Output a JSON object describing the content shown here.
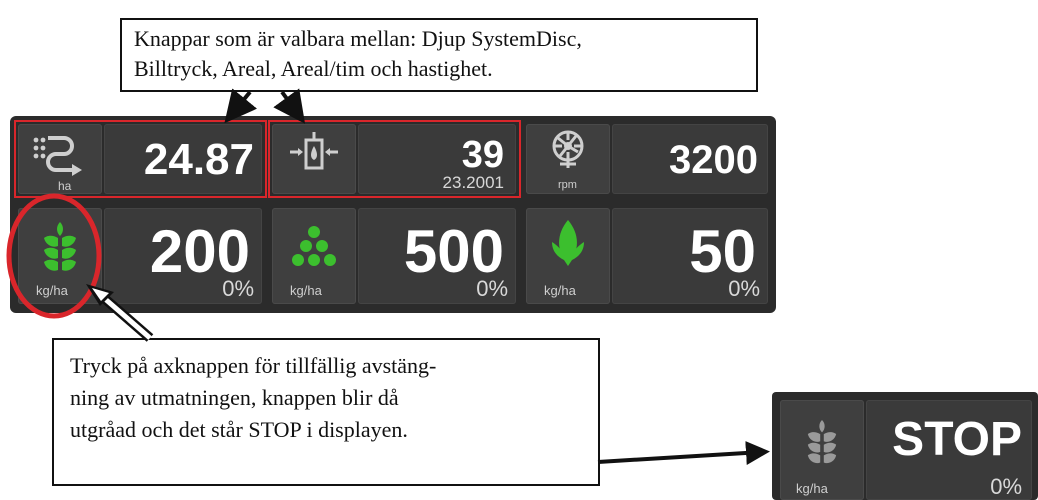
{
  "callouts": {
    "top": [
      "Knappar som är valbara mellan: Djup SystemDisc,",
      "Billtryck, Areal, Areal/tim och hastighet."
    ],
    "bottom": [
      "Tryck på  axknappen för tillfällig avstäng-",
      "ning av utmatningen, knappen blir då",
      "utgråad och det står STOP i displayen."
    ]
  },
  "display": {
    "row1": [
      {
        "icon": "area-route-icon",
        "unit": "ha",
        "value": "24.87",
        "sub": ""
      },
      {
        "icon": "pressure-depth-icon",
        "unit": "",
        "value": "39",
        "sub": "23.2001"
      },
      {
        "icon": "fan-icon",
        "unit": "rpm",
        "value": "3200",
        "sub": ""
      }
    ],
    "row2": [
      {
        "icon": "wheat-icon",
        "unit": "kg/ha",
        "value": "200",
        "sub": "0%"
      },
      {
        "icon": "seed-dots-icon",
        "unit": "kg/ha",
        "value": "500",
        "sub": "0%"
      },
      {
        "icon": "leaf-icon",
        "unit": "kg/ha",
        "value": "50",
        "sub": "0%"
      }
    ]
  },
  "stop_display": {
    "icon": "wheat-grey-icon",
    "unit": "kg/ha",
    "value": "STOP",
    "sub": "0%"
  },
  "colors": {
    "panel": "#2b2b2b",
    "cell": "#3a3a3a",
    "green": "#3cbf2e",
    "highlight": "#d9262b",
    "grey_icon": "#9a9a9a"
  }
}
